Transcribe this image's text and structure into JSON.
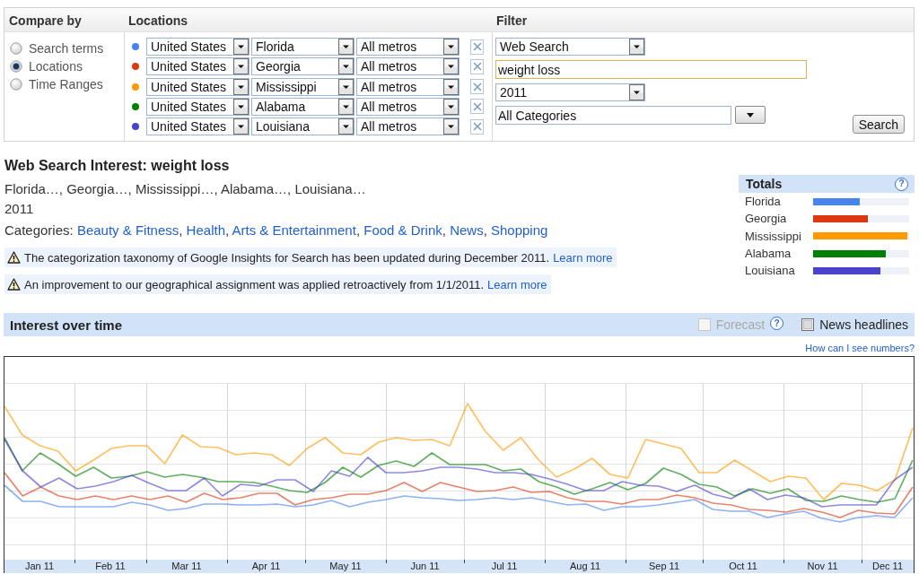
{
  "compare_by": {
    "title": "Compare by",
    "options": [
      {
        "label": "Search terms",
        "selected": false
      },
      {
        "label": "Locations",
        "selected": true
      },
      {
        "label": "Time Ranges",
        "selected": false
      }
    ]
  },
  "locations": {
    "title": "Locations",
    "rows": [
      {
        "color": "#4684ee",
        "country": "United States",
        "region": "Florida",
        "metro": "All metros"
      },
      {
        "color": "#dc3912",
        "country": "United States",
        "region": "Georgia",
        "metro": "All metros"
      },
      {
        "color": "#ff9900",
        "country": "United States",
        "region": "Mississippi",
        "metro": "All metros"
      },
      {
        "color": "#008000",
        "country": "United States",
        "region": "Alabama",
        "metro": "All metros"
      },
      {
        "color": "#4942cc",
        "country": "United States",
        "region": "Louisiana",
        "metro": "All metros"
      }
    ]
  },
  "filter": {
    "title": "Filter",
    "search_type": "Web Search",
    "query": "weight loss",
    "period": "2011",
    "category": "All Categories",
    "search_button": "Search"
  },
  "summary": {
    "title": "Web Search Interest: weight loss",
    "locations": "Florida…, Georgia…, Mississippi…, Alabama…, Louisiana…",
    "period": "2011",
    "categories_label": "Categories:",
    "categories": [
      {
        "label": "Beauty & Fitness",
        "separator": ","
      },
      {
        "label": "Health",
        "separator": ","
      },
      {
        "label": "Arts & Entertainment",
        "separator": ","
      },
      {
        "label": "Food & Drink",
        "separator": ","
      },
      {
        "label": "News",
        "separator": ","
      },
      {
        "label": "Shopping"
      }
    ],
    "notices": [
      {
        "text": "The categorization taxonomy of Google Insights for Search has been updated during December 2011.",
        "link": "Learn more"
      },
      {
        "text": "An improvement to our geographical assignment was applied retroactively from 1/1/2011.",
        "link": "Learn more"
      }
    ]
  },
  "totals": {
    "title": "Totals",
    "help": "?",
    "rows": [
      {
        "name": "Florida",
        "color": "#4684ee",
        "level": 0.49
      },
      {
        "name": "Georgia",
        "color": "#dc3912",
        "level": 0.57
      },
      {
        "name": "Mississippi",
        "color": "#ff9900",
        "level": 0.98
      },
      {
        "name": "Alabama",
        "color": "#008000",
        "level": 0.76
      },
      {
        "name": "Louisiana",
        "color": "#4942cc",
        "level": 0.7
      }
    ]
  },
  "interest": {
    "title": "Interest over time",
    "forecast": {
      "label": "Forecast",
      "checked": false,
      "disabled": true
    },
    "forecast_help": "?",
    "news_headlines": {
      "label": "News headlines",
      "checked": false,
      "disabled": false
    },
    "numbers_link": "How can I see numbers?",
    "months": [
      "Jan 11",
      "Feb 11",
      "Mar 11",
      "Apr 11",
      "May 11",
      "Jun 11",
      "Jul 11",
      "Aug 11",
      "Sep 11",
      "Oct 11",
      "Nov 11",
      "Dec 11"
    ]
  }
}
